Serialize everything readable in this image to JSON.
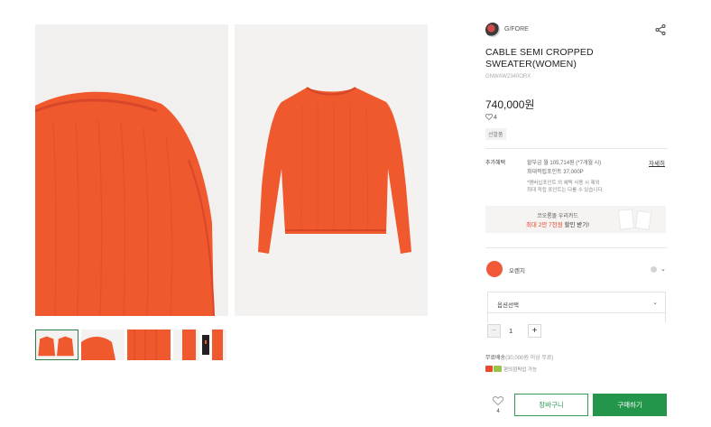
{
  "product": {
    "brand": "G/FORE",
    "title": "CABLE SEMI CROPPED SWEATER(WOMEN)",
    "sku": "GNWAW2340ORX",
    "price": "740,000원",
    "likes": "4",
    "badge": "선발품",
    "color_hex": "#f15a38"
  },
  "benefits": {
    "label": "추가혜택",
    "line1": "할부금 월 105,714원 (*7개월 시)",
    "line2": "최대적립포인트 37,000P",
    "note1": "*멤버십포인트 외 혜택 사용 시 제외",
    "note2": "최대 적립 포인트는 다를 수 있습니다.",
    "detail_link": "자세히"
  },
  "coupon": {
    "line1": "코오롱몰 우리카드",
    "line2_red": "최대 2만 7천원",
    "line2_rest": " 할인 받기!"
  },
  "options": {
    "color_name": "오렌지",
    "select_label": "옵션선택",
    "quantity": "1"
  },
  "shipping": {
    "label": "무료배송",
    "condition": "(30,000원 이상 무료)",
    "pay_note": "편의점픽업 가능"
  },
  "actions": {
    "wish_count": "4",
    "cart_label": "장바구니",
    "buy_label": "구매하기"
  },
  "icons": [
    "share-icon",
    "heart-icon",
    "chevron-down-icon",
    "minus-icon",
    "plus-icon",
    "wish-icon",
    "pay-icon"
  ]
}
